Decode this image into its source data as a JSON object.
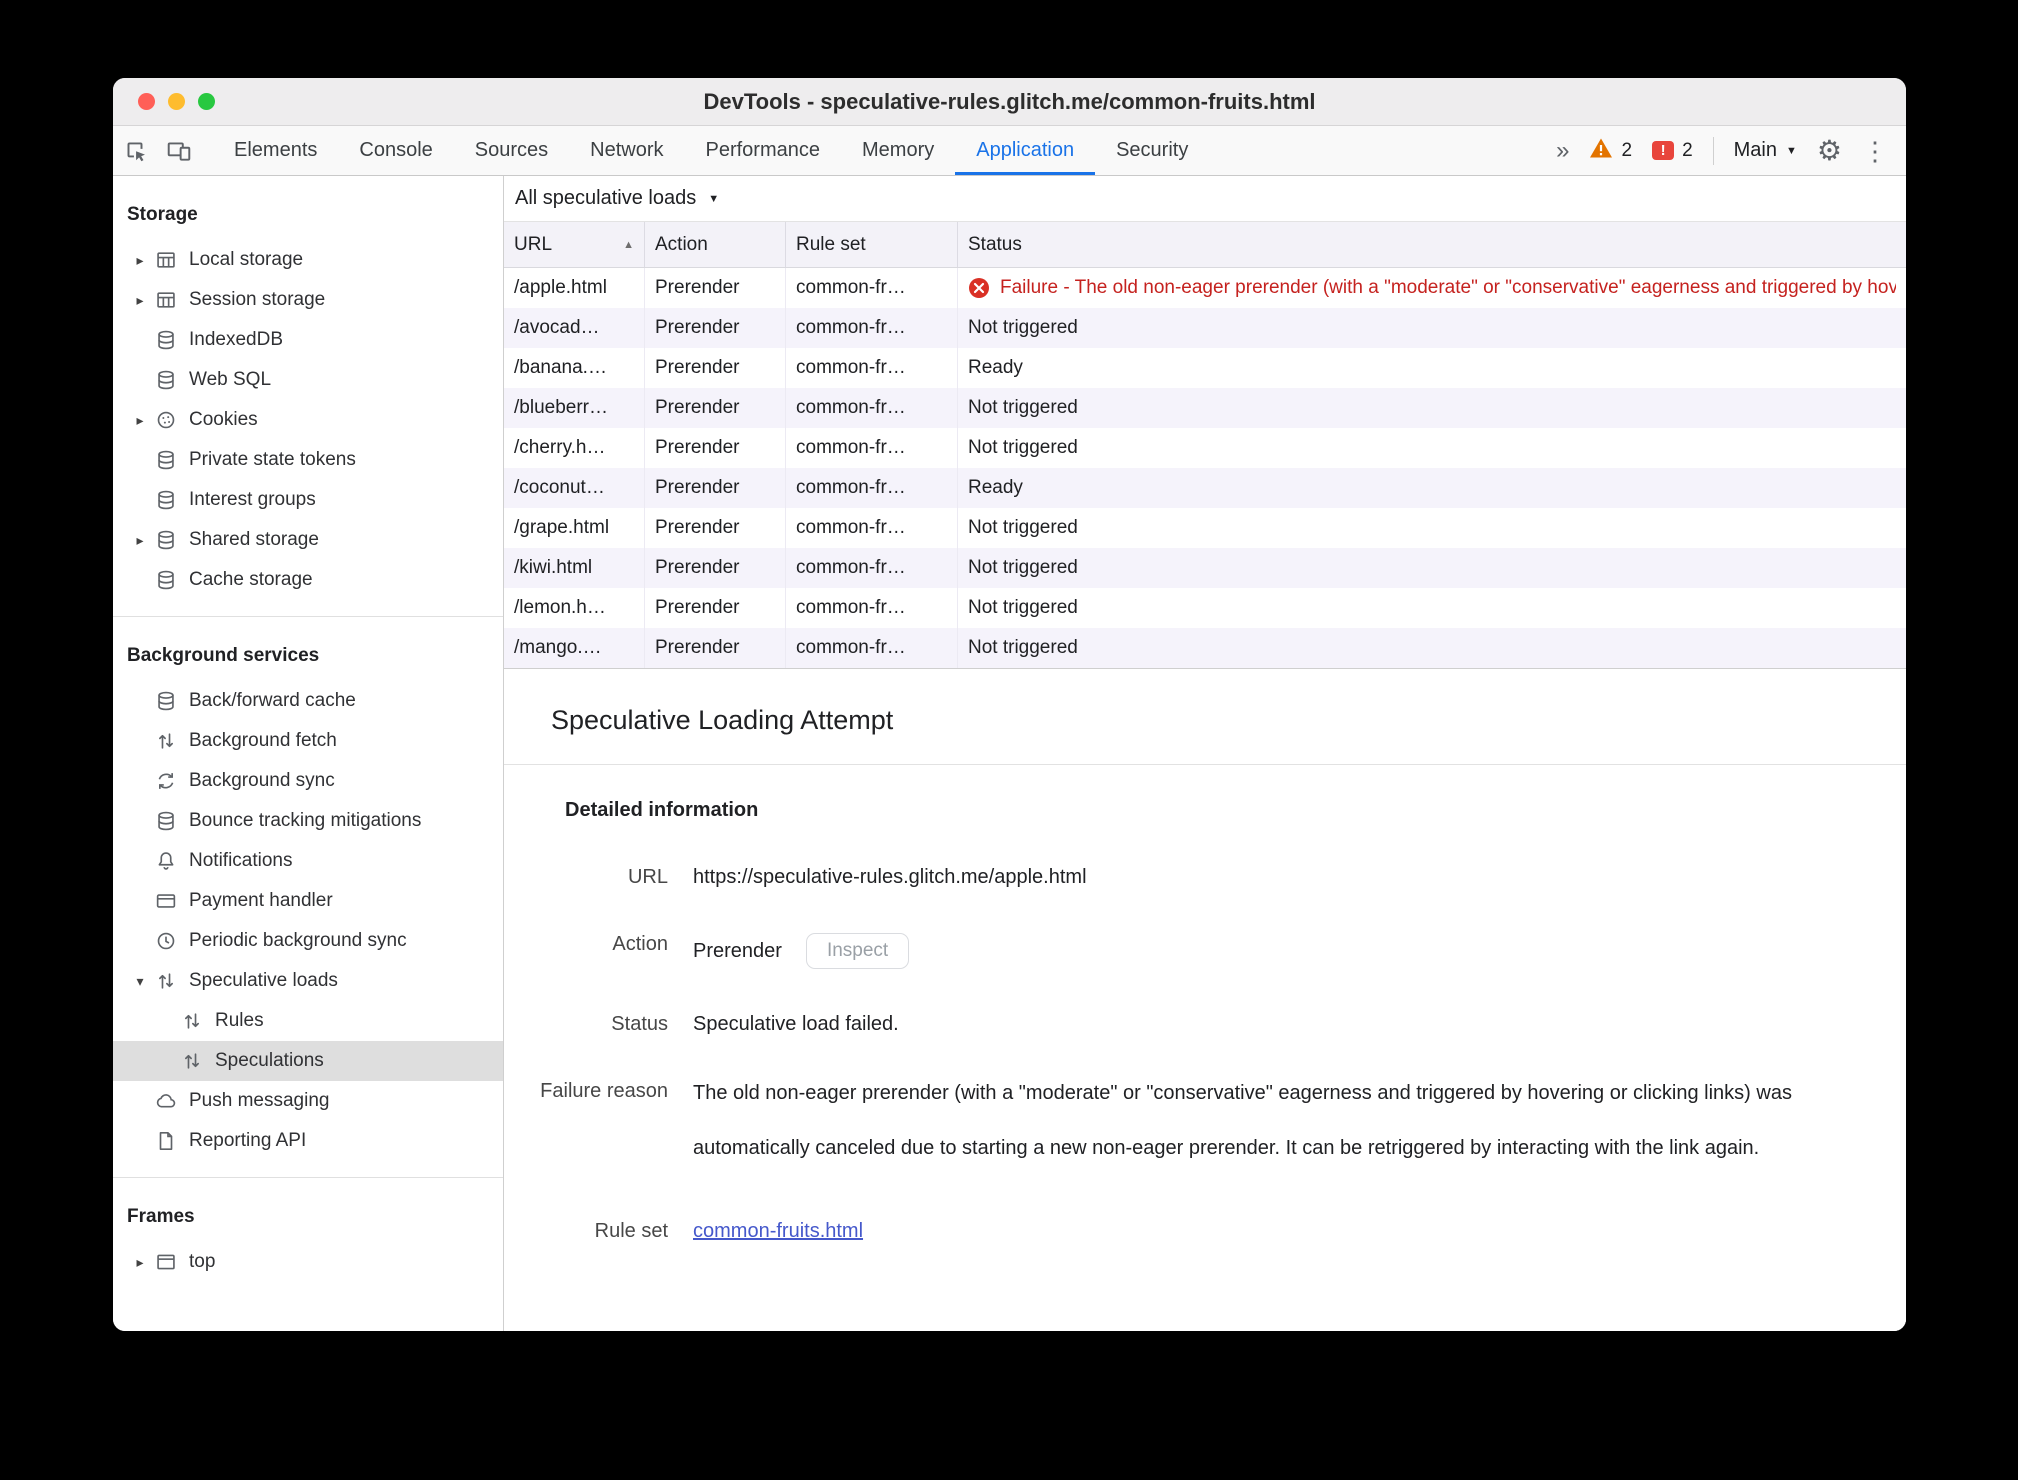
{
  "window": {
    "title": "DevTools - speculative-rules.glitch.me/common-fruits.html"
  },
  "toolbar": {
    "tabs": [
      "Elements",
      "Console",
      "Sources",
      "Network",
      "Performance",
      "Memory",
      "Application",
      "Security"
    ],
    "active_tab": "Application",
    "more_tabs_glyph": "»",
    "warning_count": "2",
    "issue_count": "2",
    "issue_glyph": "!",
    "target_label": "Main",
    "dropdown_glyph": "▼",
    "gear_glyph": "⚙",
    "kebab_glyph": "⋮"
  },
  "sidebar": {
    "sections": [
      {
        "title": "Storage",
        "items": [
          {
            "label": "Local storage",
            "icon": "table-icon",
            "expander": "▸"
          },
          {
            "label": "Session storage",
            "icon": "table-icon",
            "expander": "▸"
          },
          {
            "label": "IndexedDB",
            "icon": "database-icon"
          },
          {
            "label": "Web SQL",
            "icon": "database-icon"
          },
          {
            "label": "Cookies",
            "icon": "cookie-icon",
            "expander": "▸"
          },
          {
            "label": "Private state tokens",
            "icon": "database-icon"
          },
          {
            "label": "Interest groups",
            "icon": "database-icon"
          },
          {
            "label": "Shared storage",
            "icon": "database-icon",
            "expander": "▸"
          },
          {
            "label": "Cache storage",
            "icon": "database-icon"
          }
        ]
      },
      {
        "title": "Background services",
        "items": [
          {
            "label": "Back/forward cache",
            "icon": "database-icon"
          },
          {
            "label": "Background fetch",
            "icon": "up-down-arrows-icon"
          },
          {
            "label": "Background sync",
            "icon": "sync-icon"
          },
          {
            "label": "Bounce tracking mitigations",
            "icon": "database-icon"
          },
          {
            "label": "Notifications",
            "icon": "bell-icon"
          },
          {
            "label": "Payment handler",
            "icon": "payment-card-icon"
          },
          {
            "label": "Periodic background sync",
            "icon": "clock-icon"
          },
          {
            "label": "Speculative loads",
            "icon": "up-down-arrows-icon",
            "expander": "▾"
          },
          {
            "label": "Rules",
            "icon": "up-down-arrows-icon",
            "nested": true
          },
          {
            "label": "Speculations",
            "icon": "up-down-arrows-icon",
            "nested": true,
            "selected": true
          },
          {
            "label": "Push messaging",
            "icon": "cloud-icon"
          },
          {
            "label": "Reporting API",
            "icon": "document-icon"
          }
        ]
      },
      {
        "title": "Frames",
        "items": [
          {
            "label": "top",
            "icon": "frame-icon",
            "expander": "▸"
          }
        ]
      }
    ]
  },
  "main": {
    "filter": {
      "label": "All speculative loads",
      "dropdown_glyph": "▼"
    },
    "table": {
      "columns": [
        "URL",
        "Action",
        "Rule set",
        "Status"
      ],
      "sort_glyph": "▲",
      "rows": [
        {
          "url": "/apple.html",
          "action": "Prerender",
          "rule_set": "common-fr…",
          "status": "Failure - The old non-eager prerender (with a \"moderate\" or \"conservative\" eagerness and triggered by hovering or clicking links) was automatically canceled",
          "status_type": "failure"
        },
        {
          "url": "/avocad…",
          "action": "Prerender",
          "rule_set": "common-fr…",
          "status": "Not triggered",
          "status_type": "normal"
        },
        {
          "url": "/banana.…",
          "action": "Prerender",
          "rule_set": "common-fr…",
          "status": "Ready",
          "status_type": "normal"
        },
        {
          "url": "/blueberr…",
          "action": "Prerender",
          "rule_set": "common-fr…",
          "status": "Not triggered",
          "status_type": "normal"
        },
        {
          "url": "/cherry.h…",
          "action": "Prerender",
          "rule_set": "common-fr…",
          "status": "Not triggered",
          "status_type": "normal"
        },
        {
          "url": "/coconut…",
          "action": "Prerender",
          "rule_set": "common-fr…",
          "status": "Ready",
          "status_type": "normal"
        },
        {
          "url": "/grape.html",
          "action": "Prerender",
          "rule_set": "common-fr…",
          "status": "Not triggered",
          "status_type": "normal"
        },
        {
          "url": "/kiwi.html",
          "action": "Prerender",
          "rule_set": "common-fr…",
          "status": "Not triggered",
          "status_type": "normal"
        },
        {
          "url": "/lemon.h…",
          "action": "Prerender",
          "rule_set": "common-fr…",
          "status": "Not triggered",
          "status_type": "normal"
        },
        {
          "url": "/mango.…",
          "action": "Prerender",
          "rule_set": "common-fr…",
          "status": "Not triggered",
          "status_type": "normal"
        }
      ]
    },
    "details": {
      "title": "Speculative Loading Attempt",
      "section_title": "Detailed information",
      "url_label": "URL",
      "url_value": "https://speculative-rules.glitch.me/apple.html",
      "action_label": "Action",
      "action_value": "Prerender",
      "inspect_button_label": "Inspect",
      "status_label": "Status",
      "status_value": "Speculative load failed.",
      "failure_label": "Failure reason",
      "failure_value": "The old non-eager prerender (with a \"moderate\" or \"conservative\" eagerness and triggered by hovering or clicking links) was automatically canceled due to starting a new non-eager prerender. It can be retriggered by interacting with the link again.",
      "ruleset_label": "Rule set",
      "ruleset_link": "common-fruits.html"
    }
  },
  "colors": {
    "accent_blue": "#1a73e8",
    "failure_red": "#c5221f",
    "warning_orange": "#e37400",
    "issue_red": "#e8453c",
    "link_blue": "#4558cb",
    "selected_gray": "#dedede",
    "row_stripe": "#f5f3fb"
  }
}
